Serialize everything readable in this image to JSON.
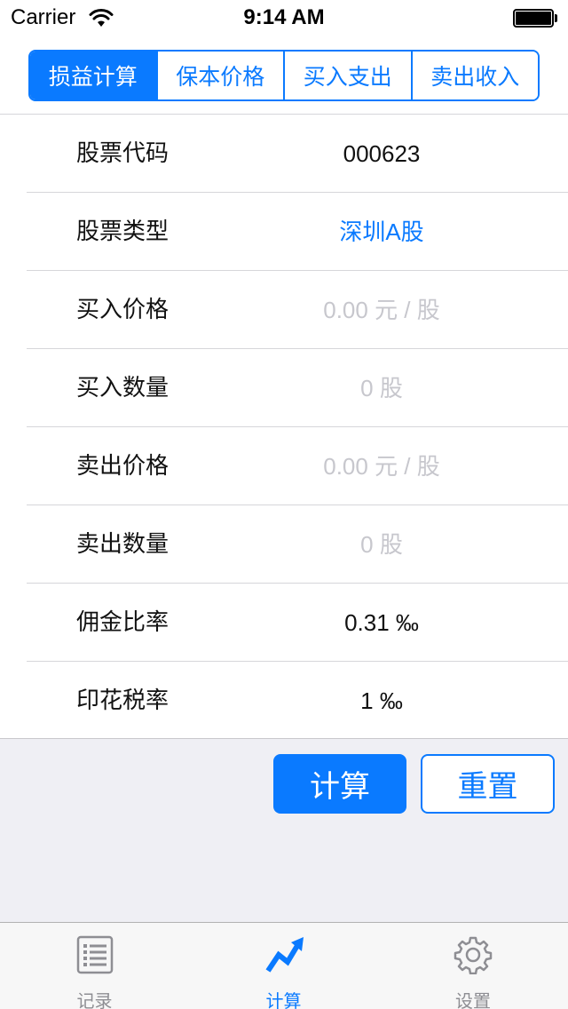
{
  "status_bar": {
    "carrier": "Carrier",
    "time": "9:14 AM"
  },
  "segments": [
    {
      "label": "损益计算",
      "active": true
    },
    {
      "label": "保本价格",
      "active": false
    },
    {
      "label": "买入支出",
      "active": false
    },
    {
      "label": "卖出收入",
      "active": false
    }
  ],
  "form": {
    "stock_code": {
      "label": "股票代码",
      "value": "000623"
    },
    "stock_type": {
      "label": "股票类型",
      "value": "深圳A股"
    },
    "buy_price": {
      "label": "买入价格",
      "placeholder": "0.00 元 / 股"
    },
    "buy_quantity": {
      "label": "买入数量",
      "placeholder": "0 股"
    },
    "sell_price": {
      "label": "卖出价格",
      "placeholder": "0.00 元 / 股"
    },
    "sell_quantity": {
      "label": "卖出数量",
      "placeholder": "0 股"
    },
    "commission_rate": {
      "label": "佣金比率",
      "value": "0.31 ‰"
    },
    "stamp_tax_rate": {
      "label": "印花税率",
      "value": "1 ‰"
    }
  },
  "actions": {
    "calculate": "计算",
    "reset": "重置"
  },
  "tab_bar": [
    {
      "label": "记录",
      "icon": "list-icon",
      "active": false
    },
    {
      "label": "计算",
      "icon": "chart-trend-icon",
      "active": true
    },
    {
      "label": "设置",
      "icon": "gear-icon",
      "active": false
    }
  ],
  "colors": {
    "accent": "#0a7aff",
    "placeholder": "#c7c7cd",
    "background_gray": "#efeff4"
  }
}
